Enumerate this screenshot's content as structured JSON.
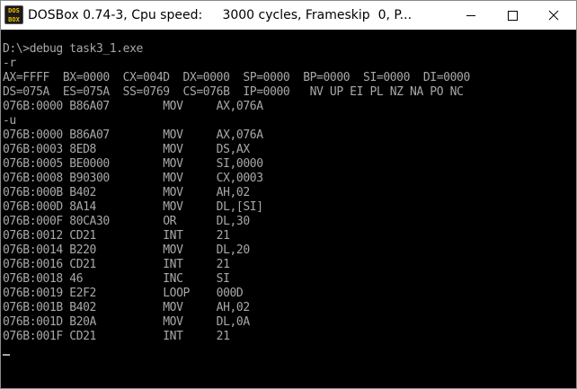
{
  "window": {
    "title": "DOSBox 0.74-3, Cpu speed:     3000 cycles, Frameskip  0, P...",
    "icon_text_top": "DOS",
    "icon_text_bottom": "BOX",
    "icons": {
      "minimize": "minimize-icon",
      "maximize": "maximize-icon",
      "close": "close-icon"
    }
  },
  "colors": {
    "console_bg": "#000000",
    "console_fg": "#a8a8a8",
    "titlebar_bg": "#ffffff"
  },
  "console": {
    "lines": [
      "D:\\>debug task3_1.exe",
      "-r",
      "AX=FFFF  BX=0000  CX=004D  DX=0000  SP=0000  BP=0000  SI=0000  DI=0000",
      "DS=075A  ES=075A  SS=0769  CS=076B  IP=0000   NV UP EI PL NZ NA PO NC",
      "076B:0000 B86A07        MOV     AX,076A",
      "-u",
      "076B:0000 B86A07        MOV     AX,076A",
      "076B:0003 8ED8          MOV     DS,AX",
      "076B:0005 BE0000        MOV     SI,0000",
      "076B:0008 B90300        MOV     CX,0003",
      "076B:000B B402          MOV     AH,02",
      "076B:000D 8A14          MOV     DL,[SI]",
      "076B:000F 80CA30        OR      DL,30",
      "076B:0012 CD21          INT     21",
      "076B:0014 B220          MOV     DL,20",
      "076B:0016 CD21          INT     21",
      "076B:0018 46            INC     SI",
      "076B:0019 E2F2          LOOP    000D",
      "076B:001B B402          MOV     AH,02",
      "076B:001D B20A          MOV     DL,0A",
      "076B:001F CD21          INT     21"
    ]
  }
}
